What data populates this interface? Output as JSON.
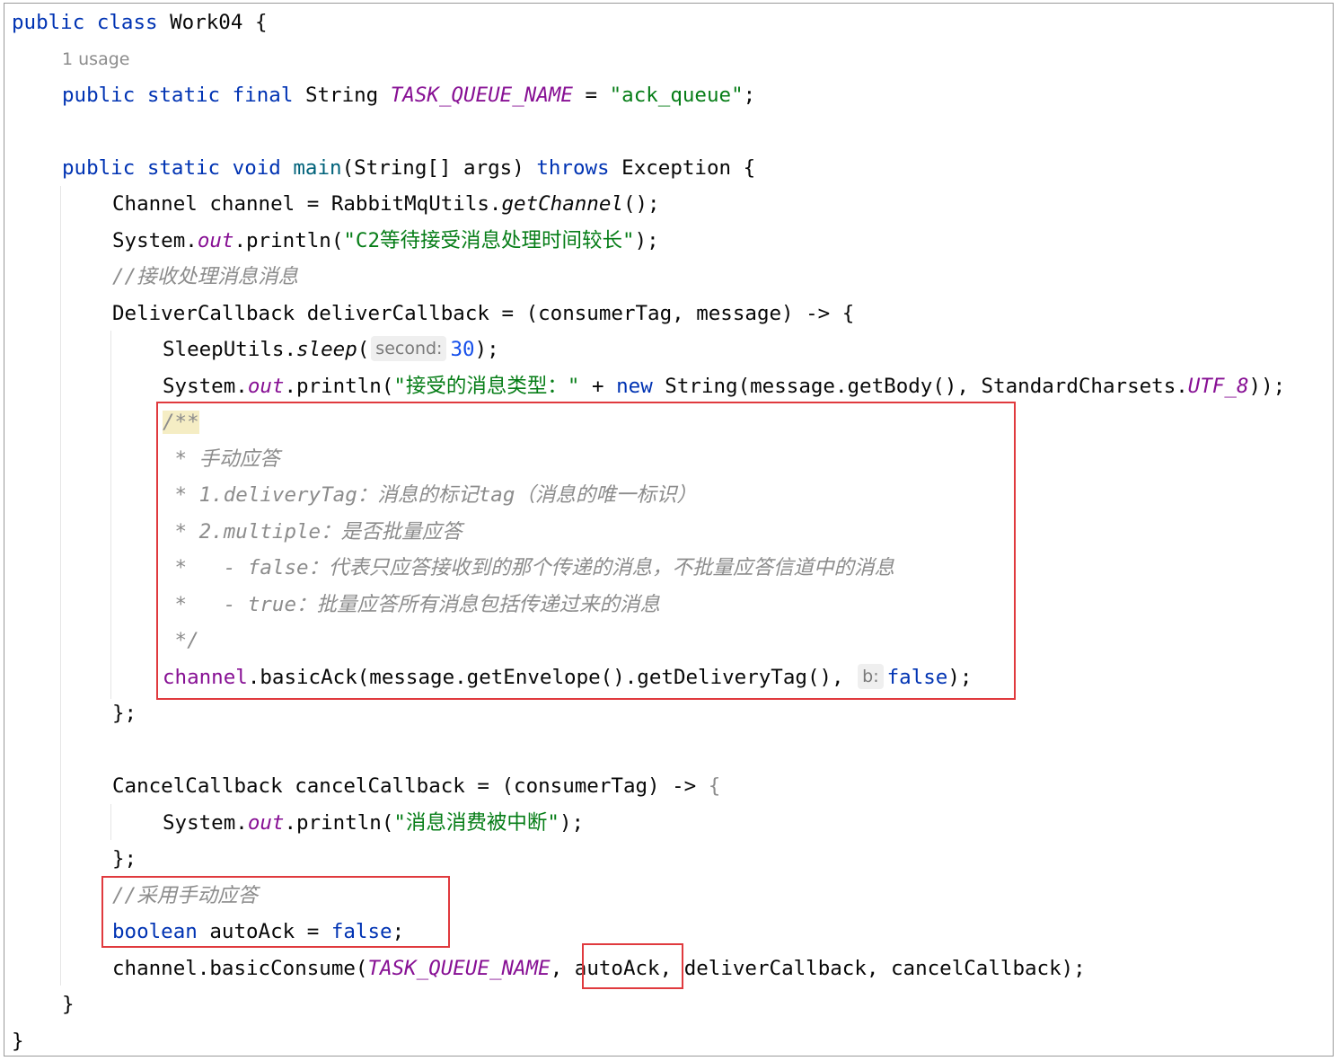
{
  "editor": {
    "class_line": {
      "kw1": "public",
      "kw2": "class",
      "name": "Work04",
      "brace": "{"
    },
    "usage_hint": "1 usage",
    "field_line": {
      "kw1": "public",
      "kw2": "static",
      "kw3": "final",
      "type": "String",
      "name": "TASK_QUEUE_NAME",
      "eq": "=",
      "value": "\"ack_queue\"",
      "end": ";"
    },
    "main_line": {
      "kw1": "public",
      "kw2": "static",
      "kw3": "void",
      "name": "main",
      "params": "(String[] args)",
      "throws": "throws",
      "exc": "Exception",
      "brace": "{"
    },
    "channel_line": {
      "pre": "Channel channel = RabbitMqUtils.",
      "call": "getChannel",
      "post": "();"
    },
    "print_c2": {
      "pre": "System.",
      "out": "out",
      "mid": ".println(",
      "str": "\"C2等待接受消息处理时间较长\"",
      "end": ");"
    },
    "comment_receive": "//接收处理消息消息",
    "deliver_line": "DeliverCallback deliverCallback = (consumerTag, message) -> {",
    "sleep_line": {
      "pre": "SleepUtils.",
      "call": "sleep",
      "open": "(",
      "hint": "second:",
      "value": "30",
      "end": ");"
    },
    "print_type": {
      "pre": "System.",
      "out": "out",
      "mid": ".println(",
      "str": "\"接受的消息类型：\"",
      "plus": " + ",
      "kw": "new",
      "post": " String(message.getBody(), StandardCharsets.",
      "const": "UTF_8",
      "end": "));"
    },
    "doc_comment": {
      "open": "/**",
      "lines": [
        " * 手动应答",
        " * 1.deliveryTag：消息的标记tag（消息的唯一标识）",
        " * 2.multiple：是否批量应答",
        " *   - false：代表只应答接收到的那个传递的消息，不批量应答信道中的消息",
        " *   - true：批量应答所有消息包括传递过来的消息",
        " */"
      ]
    },
    "basic_ack": {
      "var": "channel",
      "pre": ".basicAck(message.getEnvelope().getDeliveryTag(), ",
      "hint": "b:",
      "value": "false",
      "end": ");"
    },
    "close_deliver": "};",
    "cancel_line": {
      "text": "CancelCallback cancelCallback = (consumerTag) -> ",
      "brace": "{"
    },
    "print_cancel": {
      "pre": "System.",
      "out": "out",
      "mid": ".println(",
      "str": "\"消息消费被中断\"",
      "end": ");"
    },
    "close_cancel": "};",
    "comment_manual": "//采用手动应答",
    "autoack_line": {
      "type": "boolean",
      "mid": " autoAck = ",
      "value": "false",
      "end": ";"
    },
    "consume_line": {
      "pre": "channel.basicConsume(",
      "const": "TASK_QUEUE_NAME",
      "sep": ", ",
      "arg": "autoAck",
      "post": ", deliverCallback, cancelCallback);"
    },
    "close_main": "}",
    "close_class": "}"
  },
  "highlight_color": "#e03a3e"
}
